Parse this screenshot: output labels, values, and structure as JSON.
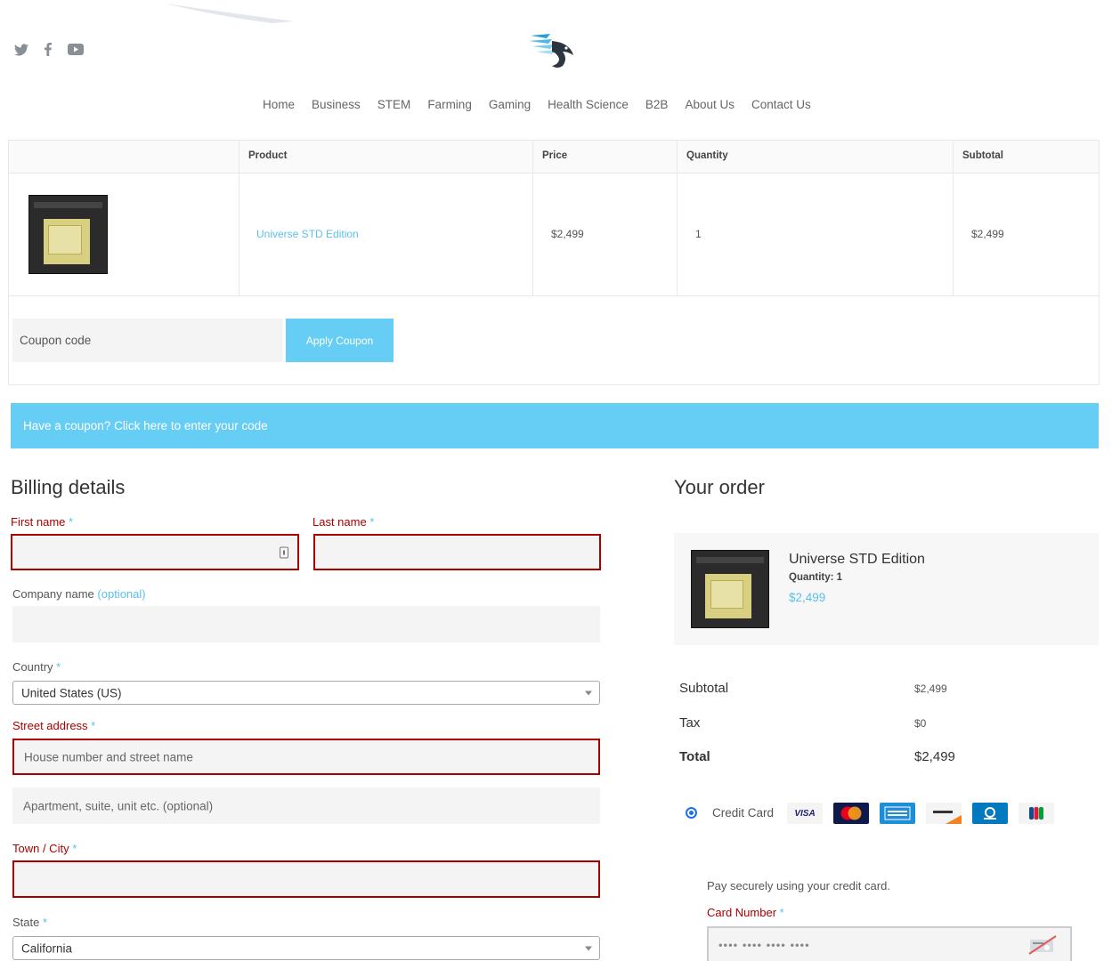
{
  "header": {
    "social": [
      "twitter-icon",
      "facebook-icon",
      "youtube-icon"
    ],
    "nav": [
      "Home",
      "Business",
      "STEM",
      "Farming",
      "Gaming",
      "Health Science",
      "B2B",
      "About Us",
      "Contact Us"
    ]
  },
  "cart": {
    "headers": {
      "product": "Product",
      "price": "Price",
      "quantity": "Quantity",
      "subtotal": "Subtotal"
    },
    "row": {
      "product": "Universe STD Edition",
      "price": "$2,499",
      "quantity": "1",
      "subtotal": "$2,499"
    },
    "coupon_placeholder": "Coupon code",
    "apply_label": "Apply Coupon"
  },
  "banner": {
    "text": "Have a coupon? Click here to enter your code"
  },
  "billing": {
    "title": "Billing details",
    "first_name": "First name",
    "last_name": "Last name",
    "company": "Company name",
    "optional": "(optional)",
    "country": "Country",
    "country_value": "United States (US)",
    "street": "Street address",
    "street_placeholder": "House number and street name",
    "apt_placeholder": "Apartment, suite, unit etc. (optional)",
    "town": "Town / City",
    "state": "State",
    "state_value": "California",
    "required_mark": "*"
  },
  "order": {
    "title": "Your order",
    "item_name": "Universe STD Edition",
    "item_qty": "Quantity: 1",
    "item_price": "$2,499",
    "subtotal_label": "Subtotal",
    "subtotal_value": "$2,499",
    "tax_label": "Tax",
    "tax_value": "$0",
    "total_label": "Total",
    "total_value": "$2,499",
    "payment_method": "Credit Card",
    "card_brands": [
      "visa",
      "mastercard",
      "amex",
      "discover",
      "diners",
      "jcb"
    ],
    "pay_desc": "Pay securely using your credit card.",
    "card_number_label": "Card Number",
    "card_number_placeholder": "•••• •••• •••• ••••"
  },
  "colors": {
    "accent": "#66cdf5",
    "error": "#aa0000",
    "link": "#5bc0eb"
  }
}
